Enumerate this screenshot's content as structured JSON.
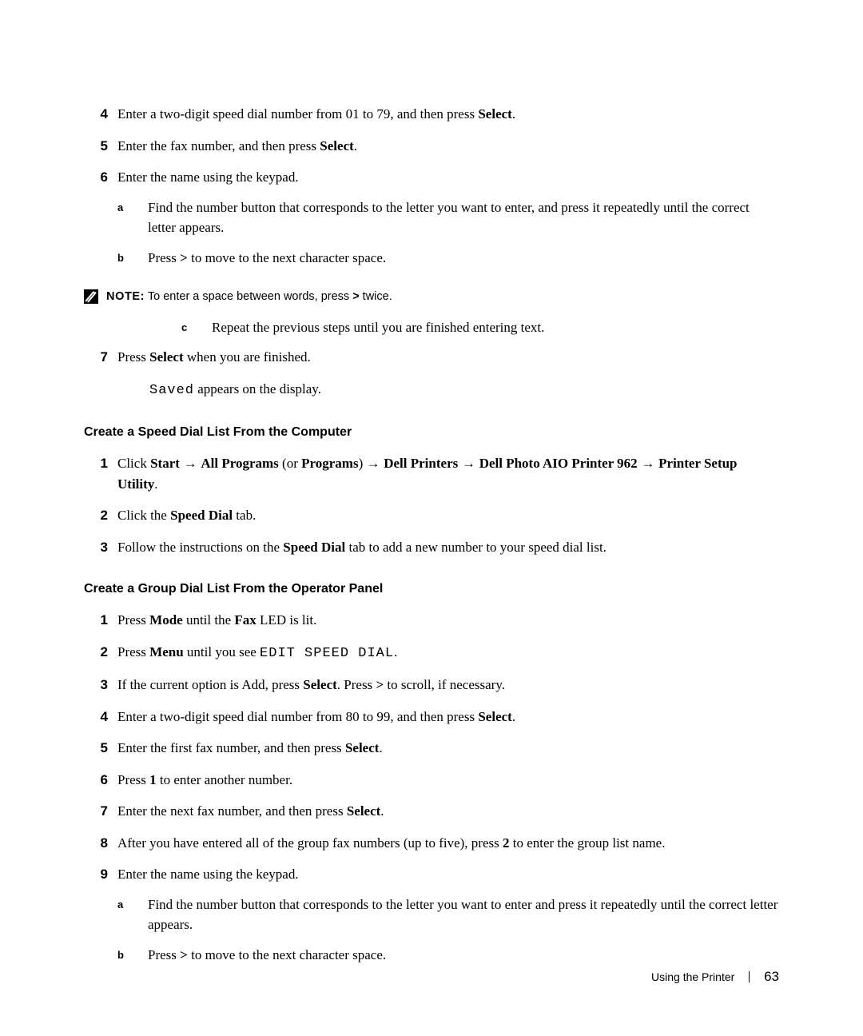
{
  "steps_a": {
    "s4": {
      "num": "4",
      "pre": "Enter a two-digit speed dial number from 01 to 79, and then press ",
      "bold": "Select",
      "post": "."
    },
    "s5": {
      "num": "5",
      "pre": "Enter the fax number, and then press ",
      "bold": "Select",
      "post": "."
    },
    "s6": {
      "num": "6",
      "text": "Enter the name using the keypad."
    },
    "s6a": {
      "marker": "a",
      "text": "Find the number button that corresponds to the letter you want to enter, and press it repeatedly until the correct letter appears."
    },
    "s6b": {
      "marker": "b",
      "pre": "Press ",
      "bold": ">",
      "post": " to move to the next character space."
    }
  },
  "note": {
    "label": "NOTE:",
    "pre": " To enter a space between words, press ",
    "bold": ">",
    "post": " twice."
  },
  "steps_a2": {
    "s6c": {
      "marker": "c",
      "text": "Repeat the previous steps until you are finished entering text."
    },
    "s7": {
      "num": "7",
      "pre": "Press ",
      "bold": "Select",
      "post": " when you are finished."
    },
    "s7_after_mono": "Saved",
    "s7_after_rest": " appears on the display."
  },
  "heading1": "Create a Speed Dial List From the Computer",
  "steps_b": {
    "s1": {
      "num": "1",
      "p_click": "Click ",
      "p_start": "Start",
      "arrow": " → ",
      "p_allprog": "All Programs",
      "p_or": " (or ",
      "p_programs": "Programs",
      "p_close": ") ",
      "p_dellp": "Dell Printers",
      "p_dellaio": "Dell Photo AIO Printer 962",
      "p_psu": "Printer Setup Utility",
      "p_end": "."
    },
    "s2": {
      "num": "2",
      "pre": "Click the ",
      "bold": "Speed Dial",
      "post": " tab."
    },
    "s3": {
      "num": "3",
      "pre": "Follow the instructions on the ",
      "bold": "Speed Dial",
      "post": " tab to add a new number to your speed dial list."
    }
  },
  "heading2": "Create a Group Dial List From the Operator Panel",
  "steps_c": {
    "s1": {
      "num": "1",
      "pre": "Press ",
      "bold": "Mode",
      "mid": " until the ",
      "bold2": "Fax",
      "post": " LED is lit."
    },
    "s2": {
      "num": "2",
      "pre": "Press ",
      "bold": "Menu",
      "mid": " until you see ",
      "mono": "EDIT SPEED DIAL",
      "post": "."
    },
    "s3": {
      "num": "3",
      "pre": "If the current option is Add, press ",
      "bold": "Select",
      "mid": ". Press ",
      "bold2": ">",
      "post": " to scroll, if necessary."
    },
    "s4": {
      "num": "4",
      "pre": "Enter a two-digit speed dial number from 80 to 99, and then press ",
      "bold": "Select",
      "post": "."
    },
    "s5": {
      "num": "5",
      "pre": "Enter the first fax number, and then press ",
      "bold": "Select",
      "post": "."
    },
    "s6": {
      "num": "6",
      "pre": "Press ",
      "bold": "1",
      "post": " to enter another number."
    },
    "s7": {
      "num": "7",
      "pre": "Enter the next fax number, and then press ",
      "bold": "Select",
      "post": "."
    },
    "s8": {
      "num": "8",
      "pre": "After you have entered all of the group fax numbers (up to five), press ",
      "bold": "2",
      "post": " to enter the group list name."
    },
    "s9": {
      "num": "9",
      "text": "Enter the name using the keypad."
    },
    "s9a": {
      "marker": "a",
      "text": "Find the number button that corresponds to the letter you want to enter and press it repeatedly until the correct letter appears."
    },
    "s9b": {
      "marker": "b",
      "pre": "Press ",
      "bold": ">",
      "post": " to move to the next character space."
    }
  },
  "footer": {
    "section": "Using the Printer",
    "page": "63"
  }
}
